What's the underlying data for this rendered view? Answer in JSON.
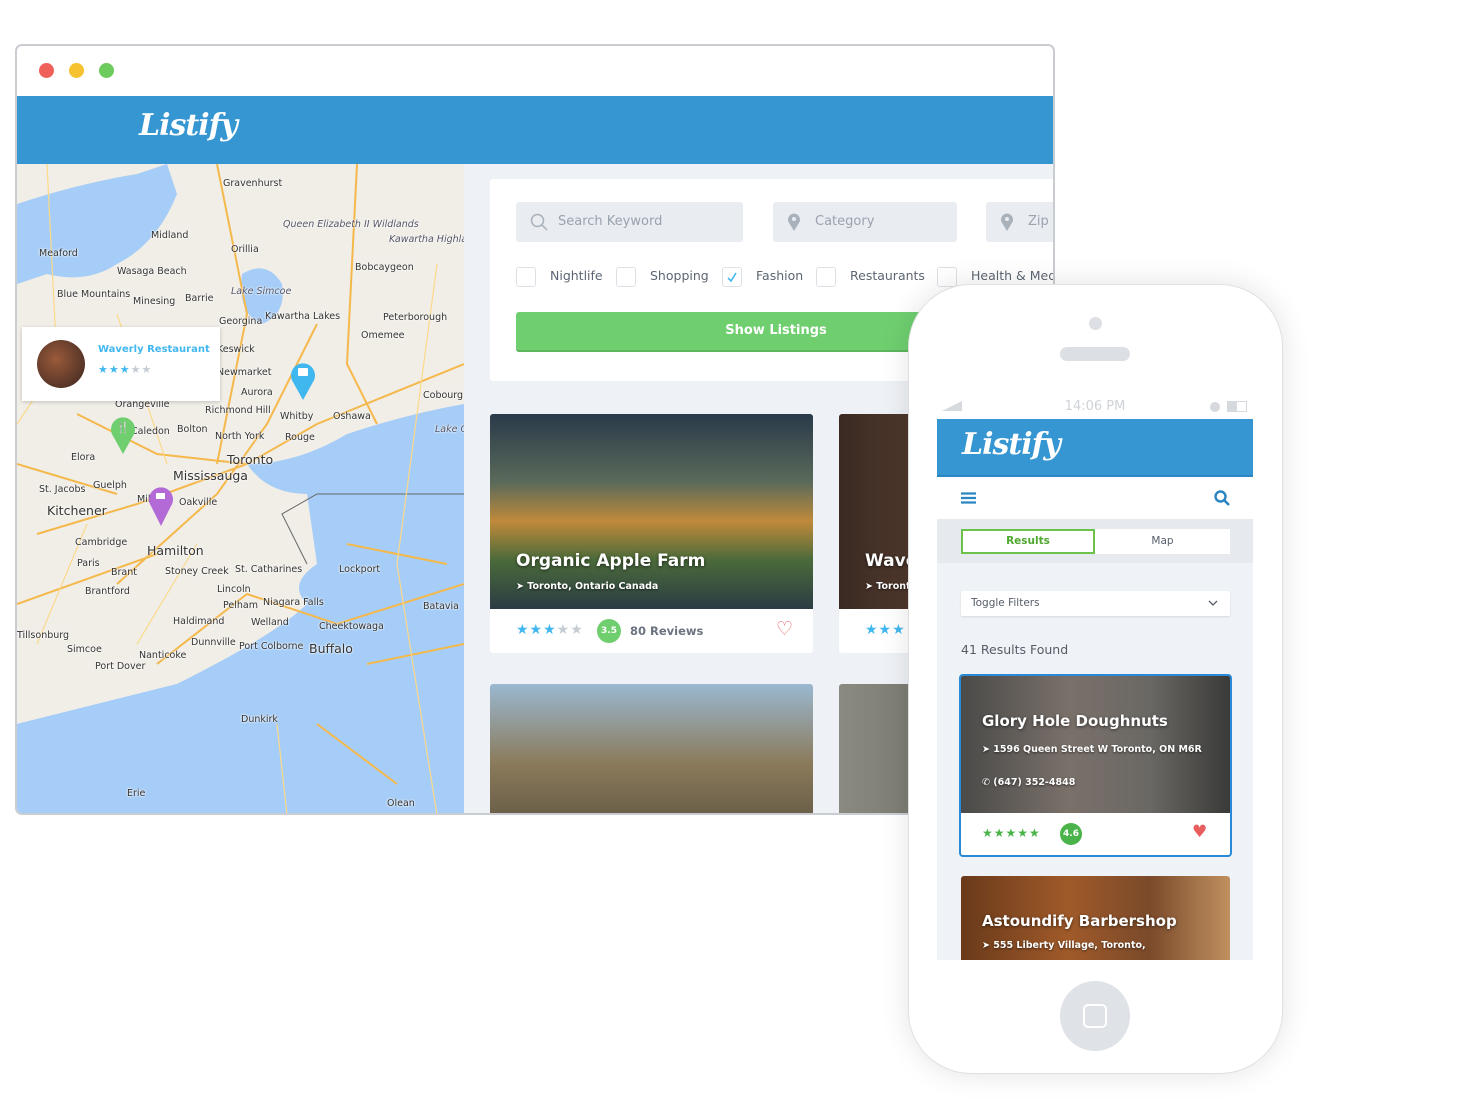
{
  "window_controls": {
    "close": "#f0605a",
    "minimize": "#f7c231",
    "maximize": "#6ccb5c"
  },
  "colors": {
    "brand": "#3596d2",
    "accent_green": "#6fcf6f",
    "star_blue": "#41b7f0",
    "heart": "#e85d5d"
  },
  "header": {
    "logo": "Listify"
  },
  "map": {
    "cities": [
      "Gravenhurst",
      "Meaford",
      "Midland",
      "Orillia",
      "Wasaga Beach",
      "Blue Mountains",
      "Barrie",
      "Minesing",
      "Bobcaygeon",
      "Georgina",
      "Kawartha Lakes",
      "Peterborough",
      "Omemee",
      "Keswick",
      "Newmarket",
      "Aurora",
      "Richmond Hill",
      "Whitby",
      "Oshawa",
      "Cobourg",
      "Orangeville",
      "Caledon",
      "Bolton",
      "North York",
      "Rouge",
      "Toronto",
      "Mississauga",
      "Elora",
      "Guelph",
      "St. Jacobs",
      "Kitchener",
      "Milton",
      "Oakville",
      "Cambridge",
      "Hamilton",
      "Paris",
      "Brant",
      "Brantford",
      "Stoney Creek",
      "St. Catharines",
      "Lincoln",
      "Lockport",
      "Niagara Falls",
      "Pelham",
      "Welland",
      "Haldimand",
      "Cheektowaga",
      "Buffalo",
      "Batavia",
      "Simcoe",
      "Dunnville",
      "Port Colborne",
      "Nanticoke",
      "Port Dover",
      "Tillsonburg",
      "Dunkirk",
      "Erie",
      "Olean",
      "Queen Elizabeth II Wildlands",
      "Kawartha Highlands Provincial Park",
      "Lake Simcoe",
      "Lake Ontario"
    ],
    "popup": {
      "name": "Waverly Restaurant",
      "rating": 3,
      "max": 5
    },
    "markers": [
      {
        "icon": "restaurant-icon",
        "color": "#6fcf6f"
      },
      {
        "icon": "coffee-icon",
        "color": "#b36ad6"
      },
      {
        "icon": "shop-icon",
        "color": "#41b7f0"
      }
    ]
  },
  "search": {
    "keyword_placeholder": "Search Keyword",
    "category_placeholder": "Category",
    "zip_placeholder": "Zip Code",
    "filters": [
      {
        "label": "Nightlife",
        "checked": false
      },
      {
        "label": "Shopping",
        "checked": false
      },
      {
        "label": "Fashion",
        "checked": true
      },
      {
        "label": "Restaurants",
        "checked": false
      },
      {
        "label": "Health & Medical",
        "checked": false
      }
    ],
    "submit": "Show Listings"
  },
  "listings": [
    {
      "title": "Organic Apple Farm",
      "location": "Toronto, Ontario Canada",
      "rating": 3,
      "score": "3.5",
      "reviews": "80 Reviews",
      "favorite": false
    },
    {
      "title": "Waverly Restaurant",
      "location": "Toronto",
      "rating": 3
    }
  ],
  "phone": {
    "time": "14:06 PM",
    "logo": "Listify",
    "tabs": [
      {
        "label": "Results",
        "active": true
      },
      {
        "label": "Map",
        "active": false
      }
    ],
    "toggle_filters": "Toggle Filters",
    "results_count": "41 Results Found",
    "listings": [
      {
        "title": "Glory Hole Doughnuts",
        "address": "1596 Queen Street W Toronto, ON M6R",
        "phone": "(647) 352-4848",
        "rating": 5,
        "score": "4.6",
        "favorite": true
      },
      {
        "title": "Astoundify Barbershop",
        "address": "555 Liberty Village, Toronto,"
      }
    ]
  }
}
